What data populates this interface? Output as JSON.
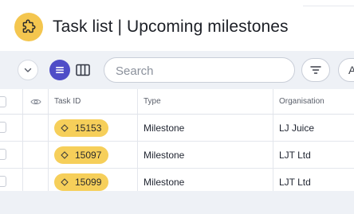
{
  "header": {
    "title": "Task list | Upcoming milestones",
    "app_icon": "puzzle-icon"
  },
  "toolbar": {
    "collapse_icon": "chevron-down-icon",
    "view_list_icon": "list-view-icon",
    "view_columns_icon": "columns-view-icon",
    "search_placeholder": "Search",
    "search_value": "",
    "filter_icon": "filter-icon",
    "more_label": "A"
  },
  "table": {
    "columns": [
      "Task ID",
      "Type",
      "Organisation"
    ],
    "visibility_icon": "eye-icon",
    "rows": [
      {
        "task_id": "15153",
        "type": "Milestone",
        "organisation": "LJ Juice"
      },
      {
        "task_id": "15097",
        "type": "Milestone",
        "organisation": "LJT Ltd"
      },
      {
        "task_id": "15099",
        "type": "Milestone",
        "organisation": "LJT Ltd"
      }
    ]
  },
  "colors": {
    "accent": "#4f4dc7",
    "badge": "#f6cf5a",
    "app_icon_bg": "#f4c64f",
    "toolbar_bg": "#eef1f6"
  }
}
